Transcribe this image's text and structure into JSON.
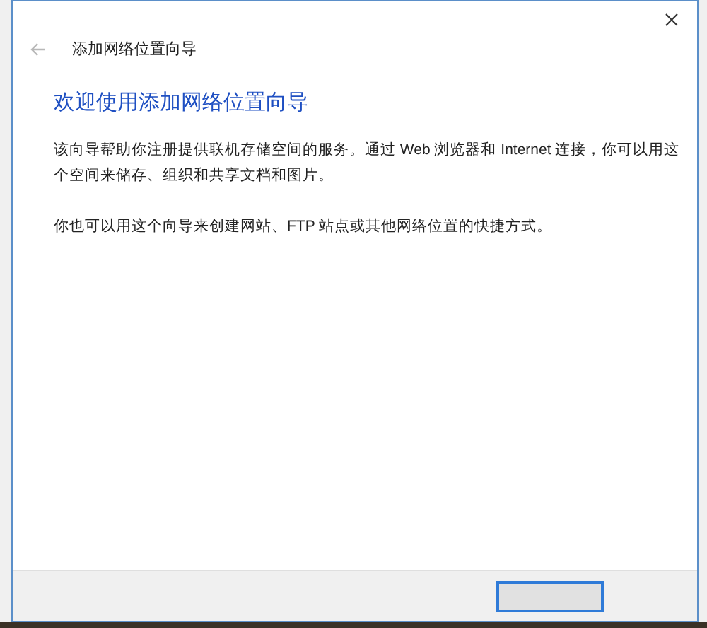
{
  "window": {
    "title": "添加网络位置向导"
  },
  "heading": "欢迎使用添加网络位置向导",
  "paragraphs": [
    "该向导帮助你注册提供联机存储空间的服务。通过 Web 浏览器和 Internet 连接，你可以用这个空间来储存、组织和共享文档和图片。",
    "你也可以用这个向导来创建网站、FTP 站点或其他网络位置的快捷方式。"
  ],
  "buttons": [
    {
      "kind": "next",
      "disabled": false
    }
  ]
}
